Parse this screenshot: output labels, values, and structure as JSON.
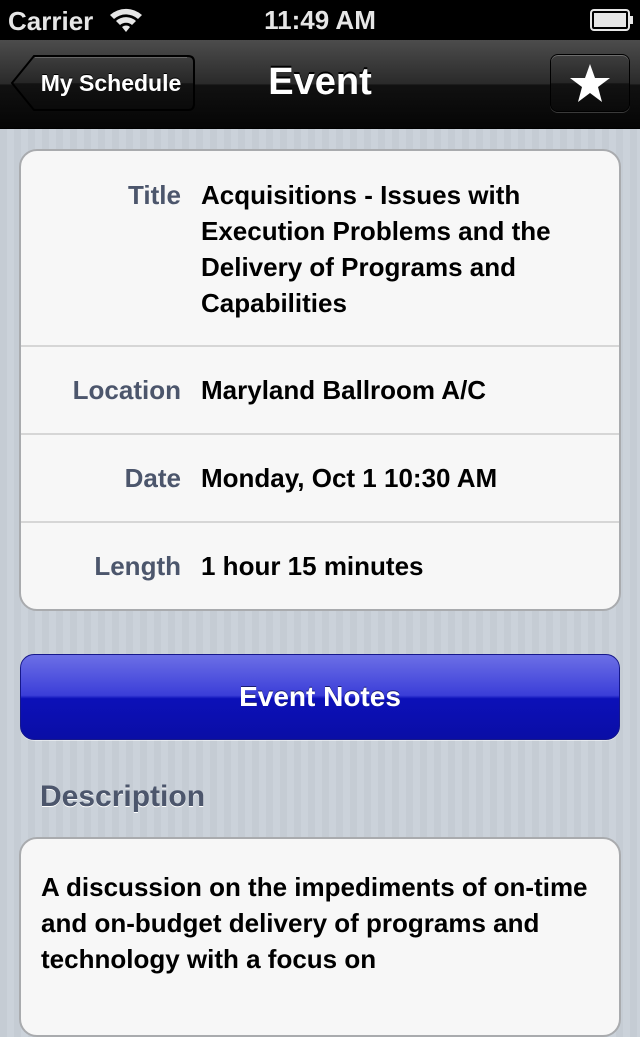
{
  "status_bar": {
    "carrier": "Carrier",
    "time": "11:49 AM",
    "wifi_icon": "wifi-icon",
    "battery_icon": "battery-icon"
  },
  "nav_bar": {
    "back_label": "My Schedule",
    "title": "Event",
    "star_icon": "star-icon"
  },
  "details": {
    "title_label": "Title",
    "title_value": "Acquisitions - Issues with Execution Problems and the Delivery of Programs and Capabilities",
    "location_label": "Location",
    "location_value": "Maryland Ballroom A/C",
    "date_label": "Date",
    "date_value": "Monday, Oct 1 10:30 AM",
    "length_label": "Length",
    "length_value": "1 hour 15 minutes"
  },
  "actions": {
    "notes_label": "Event Notes"
  },
  "description": {
    "heading": "Description",
    "text": "A discussion on the impediments of on-time and on-budget delivery of programs and technology with a focus on"
  },
  "colors": {
    "nav_background": "#111111",
    "label_color": "#4c566c",
    "notes_button": "#0c10b8",
    "page_background": "#c5ccd4"
  }
}
